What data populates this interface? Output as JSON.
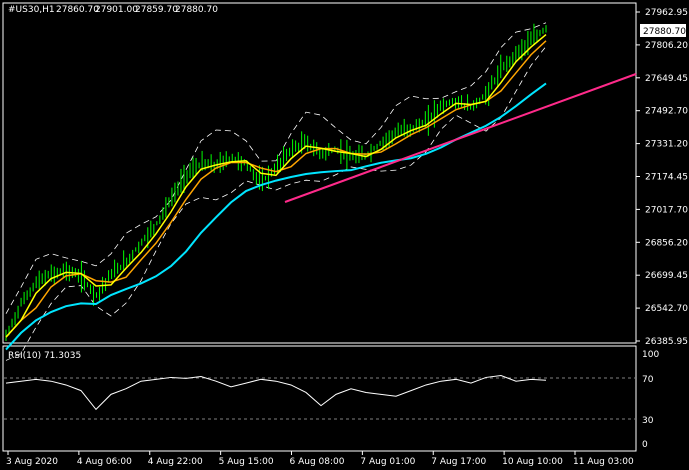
{
  "symbol_header": {
    "symbol": "#US30,H1",
    "open": "27860.70",
    "high": "27901.00",
    "low": "27859.70",
    "close": "27880.70"
  },
  "price_axis": [
    "27962.95",
    "27806.20",
    "27649.45",
    "27492.70",
    "27331.20",
    "27174.45",
    "27017.70",
    "26856.20",
    "26699.45",
    "26542.70",
    "26385.95"
  ],
  "current_price": "27880.70",
  "rsi": {
    "label": "RSI(10) 71.3035",
    "levels": [
      "100",
      "70",
      "30",
      "0"
    ]
  },
  "time_axis": [
    "3 Aug 2020",
    "4 Aug 06:00",
    "4 Aug 22:00",
    "5 Aug 15:00",
    "6 Aug 08:00",
    "7 Aug 01:00",
    "7 Aug 17:00",
    "10 Aug 10:00",
    "11 Aug 03:00"
  ],
  "colors": {
    "background": "#000000",
    "candles": "#00ff00",
    "ma_fast": "#ffff00",
    "ma_slow": "#ffa500",
    "ma_long": "#00e5ff",
    "trendline": "#ff2a8a",
    "bands": "#ffffff",
    "grid": "#808080"
  },
  "chart_data": {
    "type": "line",
    "series": [
      {
        "values": [
          26400,
          26560,
          26660,
          26700,
          26720,
          26690,
          26600,
          26700,
          26760,
          26850,
          26940,
          27060,
          27180,
          27230,
          27220,
          27260,
          27230,
          27140,
          27210,
          27300,
          27330,
          27280,
          27300,
          27260,
          27270,
          27330,
          27380,
          27400,
          27430,
          27510,
          27530,
          27500,
          27560,
          27680,
          27760,
          27820,
          27880
        ]
      }
    ],
    "rsi_values": [
      68,
      70,
      72,
      70,
      66,
      60,
      40,
      56,
      62,
      70,
      72,
      74,
      73,
      75,
      70,
      64,
      68,
      72,
      70,
      66,
      58,
      44,
      56,
      62,
      58,
      56,
      54,
      60,
      66,
      70,
      72,
      68,
      74,
      76,
      70,
      72,
      71
    ],
    "ylim": [
      26385.95,
      27962.95
    ]
  }
}
